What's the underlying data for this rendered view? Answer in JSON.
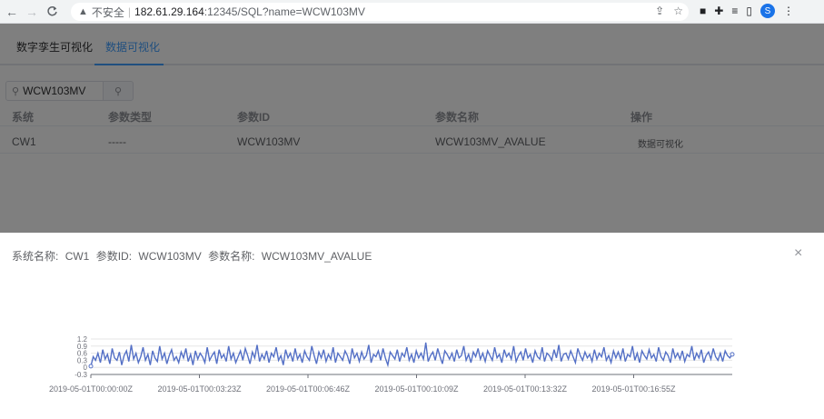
{
  "browser": {
    "back_glyph": "←",
    "forward_glyph": "→",
    "reload_glyph": "C",
    "security_icon": "warning-icon",
    "security_text": "不安全",
    "separator": "|",
    "url_host": "182.61.29.164",
    "url_rest": ":12345/SQL?name=WCW103MV",
    "profile_initial": "S"
  },
  "tabs": [
    {
      "label": "数字孪生可视化",
      "active": false
    },
    {
      "label": "数据可视化",
      "active": true
    }
  ],
  "search": {
    "value": "WCW103MV"
  },
  "table": {
    "headers": [
      "系统",
      "参数类型",
      "参数ID",
      "参数名称",
      "操作"
    ],
    "rows": [
      {
        "system": "CW1",
        "param_type": "-----",
        "param_id": "WCW103MV",
        "param_name": "WCW103MV_AVALUE",
        "action": "数据可视化"
      }
    ]
  },
  "dialog": {
    "system_label": "系统名称:",
    "system_value": "CW1",
    "param_id_label": "参数ID:",
    "param_id_value": "WCW103MV",
    "param_name_label": "参数名称:",
    "param_name_value": "WCW103MV_AVALUE",
    "close_glyph": "×"
  },
  "colors": {
    "accent": "#409eff",
    "series": "#5470c6"
  },
  "chart_data": {
    "type": "line",
    "title": "",
    "xlabel": "",
    "ylabel": "",
    "x_ticks": [
      "2019-05-01T00:00:00Z",
      "2019-05-01T00:03:23Z",
      "2019-05-01T00:06:46Z",
      "2019-05-01T00:10:09Z",
      "2019-05-01T00:13:32Z",
      "2019-05-01T00:16:55Z"
    ],
    "y_ticks": [
      1.2,
      0.9,
      0.6,
      0.3,
      0,
      -0.3
    ],
    "ylim": [
      -0.3,
      1.2
    ],
    "grid": true,
    "series": [
      {
        "values": [
          0.05,
          0.45,
          0.3,
          0.6,
          0.2,
          0.75,
          0.35,
          0.55,
          0.15,
          0.8,
          0.4,
          0.3,
          0.65,
          0.1,
          0.5,
          0.7,
          0.25,
          0.95,
          0.35,
          0.6,
          0.2,
          0.45,
          0.85,
          0.3,
          0.55,
          0.1,
          0.7,
          0.4,
          0.25,
          0.9,
          0.35,
          0.6,
          0.15,
          0.5,
          0.75,
          0.3,
          0.45,
          0.2,
          0.65,
          0.4,
          0.8,
          0.25,
          0.55,
          0.1,
          0.7,
          0.35,
          0.6,
          0.45,
          0.2,
          0.85,
          0.3,
          0.5,
          0.65,
          0.15,
          0.75,
          0.4,
          0.55,
          0.25,
          0.9,
          0.35,
          0.6,
          0.2,
          0.45,
          0.7,
          0.3,
          0.8,
          0.5,
          0.15,
          0.65,
          0.4,
          0.95,
          0.25,
          0.55,
          0.35,
          0.7,
          0.2,
          0.6,
          0.45,
          0.85,
          0.3,
          0.5,
          0.1,
          0.75,
          0.4,
          0.6,
          0.25,
          0.8,
          0.35,
          0.55,
          0.2,
          0.7,
          0.45,
          0.3,
          0.9,
          0.5,
          0.15,
          0.65,
          0.4,
          0.75,
          0.25,
          0.55,
          0.35,
          0.85,
          0.2,
          0.6,
          0.45,
          0.3,
          0.7,
          0.5,
          0.15,
          0.8,
          0.4,
          0.6,
          0.25,
          0.65,
          0.35,
          0.5,
          0.95,
          0.2,
          0.55,
          0.45,
          0.7,
          0.3,
          0.8,
          0.4,
          0.1,
          0.65,
          0.5,
          0.35,
          0.75,
          0.25,
          0.6,
          0.45,
          0.85,
          0.3,
          0.55,
          0.2,
          0.7,
          0.4,
          0.6,
          0.35,
          1.05,
          0.25,
          0.5,
          0.65,
          0.3,
          0.8,
          0.45,
          0.15,
          0.7,
          0.55,
          0.35,
          0.6,
          0.25,
          0.75,
          0.4,
          0.5,
          0.9,
          0.3,
          0.55,
          0.2,
          0.65,
          0.45,
          0.8,
          0.35,
          0.6,
          0.25,
          0.7,
          0.5,
          0.3,
          0.85,
          0.4,
          0.55,
          0.2,
          0.75,
          0.45,
          0.6,
          0.35,
          0.9,
          0.25,
          0.5,
          0.65,
          0.3,
          0.8,
          0.4,
          0.55,
          0.2,
          0.7,
          0.45,
          0.35,
          0.85,
          0.25,
          0.6,
          0.5,
          0.3,
          0.75,
          0.4,
          0.95,
          0.25,
          0.55,
          0.6,
          0.35,
          0.7,
          0.45,
          0.2,
          0.8,
          0.5,
          0.3,
          0.65,
          0.4,
          0.55,
          0.25,
          0.75,
          0.35,
          0.6,
          0.45,
          0.85,
          0.3,
          0.5,
          0.2,
          0.7,
          0.4,
          0.65,
          0.35,
          0.8,
          0.25,
          0.55,
          0.45,
          0.9,
          0.3,
          0.6,
          0.2,
          0.7,
          0.5,
          0.35,
          0.75,
          0.4,
          0.55,
          0.25,
          0.85,
          0.45,
          0.3,
          0.65,
          0.5,
          0.2,
          0.8,
          0.4,
          0.6,
          0.35,
          0.7,
          0.25,
          0.55,
          0.45,
          0.9,
          0.3,
          0.6,
          0.4,
          0.75,
          0.2,
          0.5,
          0.65,
          0.35,
          0.8,
          0.45,
          0.3,
          0.6,
          0.25,
          0.7,
          0.5,
          0.4,
          0.55
        ]
      }
    ]
  }
}
